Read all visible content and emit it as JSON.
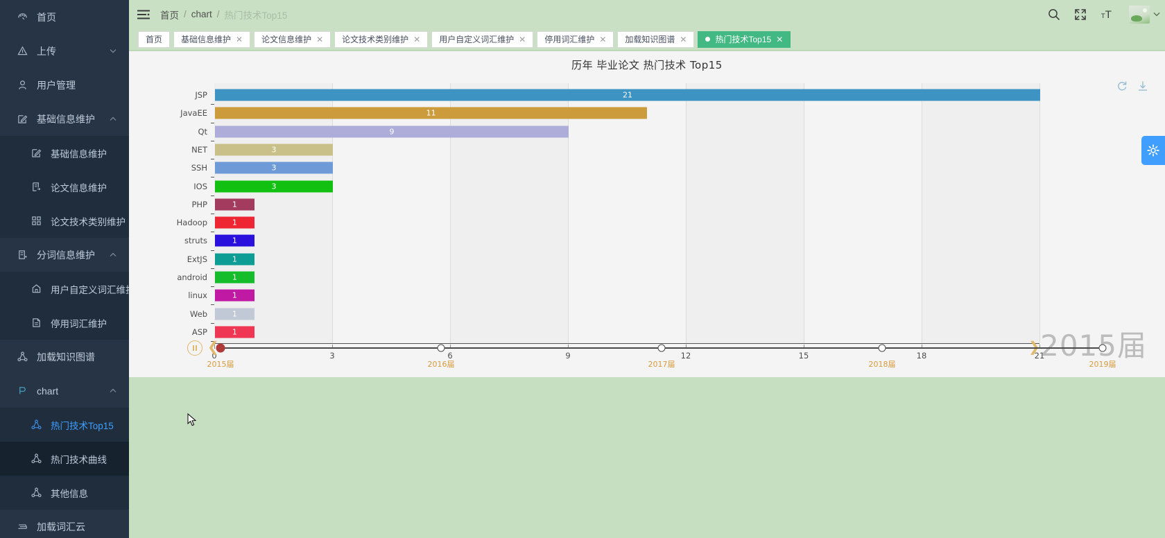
{
  "sidebar": {
    "items": [
      {
        "id": "home",
        "label": "首页",
        "icon": "dashboard-icon",
        "level": 0,
        "arrow": null
      },
      {
        "id": "upload",
        "label": "上传",
        "icon": "upload-icon",
        "level": 0,
        "arrow": "down"
      },
      {
        "id": "user-manage",
        "label": "用户管理",
        "icon": "user-icon",
        "level": 0,
        "arrow": null
      },
      {
        "id": "base-info",
        "label": "基础信息维护",
        "icon": "edit-icon",
        "level": 0,
        "arrow": "up"
      },
      {
        "id": "base-info-child",
        "label": "基础信息维护",
        "icon": "edit-icon",
        "level": 1,
        "arrow": null
      },
      {
        "id": "paper-info",
        "label": "论文信息维护",
        "icon": "doc-icon",
        "level": 1,
        "arrow": null
      },
      {
        "id": "paper-tech-cat",
        "label": "论文技术类别维护",
        "icon": "grid-icon",
        "level": 1,
        "arrow": null
      },
      {
        "id": "seg-info",
        "label": "分词信息维护",
        "icon": "book-icon",
        "level": 0,
        "arrow": "up"
      },
      {
        "id": "user-dict",
        "label": "用户自定义词汇维护",
        "icon": "tag-icon",
        "level": 1,
        "arrow": null
      },
      {
        "id": "stop-words",
        "label": "停用词汇维护",
        "icon": "file-icon",
        "level": 1,
        "arrow": null
      },
      {
        "id": "load-kg",
        "label": "加载知识图谱",
        "icon": "share-icon",
        "level": 0,
        "arrow": null
      },
      {
        "id": "chart",
        "label": "chart",
        "icon": "chart-icon",
        "level": 0,
        "arrow": "up"
      },
      {
        "id": "hot-tech-top15",
        "label": "热门技术Top15",
        "icon": "share-icon",
        "level": 1,
        "arrow": null
      },
      {
        "id": "hot-tech-curve",
        "label": "热门技术曲线",
        "icon": "share-icon",
        "level": 1,
        "arrow": null
      },
      {
        "id": "other-info",
        "label": "其他信息",
        "icon": "share-icon",
        "level": 1,
        "arrow": null
      },
      {
        "id": "load-wordcloud",
        "label": "加载词汇云",
        "icon": "cloud-icon",
        "level": 0,
        "arrow": null
      }
    ]
  },
  "header": {
    "hamburger_icon": "hamburger-icon",
    "breadcrumb": [
      "首页",
      "chart",
      "热门技术Top15"
    ],
    "separator": "/",
    "icons": [
      "search-icon",
      "fullscreen-icon",
      "text-size-icon"
    ],
    "avatar_caret": "▾"
  },
  "tabs": [
    {
      "label": "首页",
      "closable": false,
      "active": false
    },
    {
      "label": "基础信息维护",
      "closable": true,
      "active": false
    },
    {
      "label": "论文信息维护",
      "closable": true,
      "active": false
    },
    {
      "label": "论文技术类别维护",
      "closable": true,
      "active": false
    },
    {
      "label": "用户自定义词汇维护",
      "closable": true,
      "active": false
    },
    {
      "label": "停用词汇维护",
      "closable": true,
      "active": false
    },
    {
      "label": "加载知识图谱",
      "closable": true,
      "active": false
    },
    {
      "label": "热门技术Top15",
      "closable": true,
      "active": true
    }
  ],
  "chart_tools": [
    {
      "name": "refresh-icon"
    },
    {
      "name": "download-icon"
    }
  ],
  "chart_data": {
    "type": "bar",
    "orientation": "horizontal",
    "title": "历年 毕业论文 热门技术 Top15",
    "xlabel": "",
    "ylabel": "",
    "xlim": [
      0,
      21
    ],
    "xticks": [
      0,
      3,
      6,
      9,
      12,
      15,
      18,
      21
    ],
    "grid": true,
    "watermark": "2015届",
    "categories": [
      "JSP",
      "JavaEE",
      "Qt",
      "NET",
      "SSH",
      "IOS",
      "PHP",
      "Hadoop",
      "struts",
      "ExtJS",
      "android",
      "linux",
      "Web",
      "ASP"
    ],
    "values": [
      21,
      11,
      9,
      3,
      3,
      3,
      1,
      1,
      1,
      1,
      1,
      1,
      1,
      1
    ],
    "colors": [
      "#3d93c1",
      "#cb9b3c",
      "#aeadd9",
      "#c9c089",
      "#6e9bd8",
      "#12c012",
      "#a33b5e",
      "#ee2634",
      "#2a10dd",
      "#0e9d94",
      "#16bd2b",
      "#c01aa5",
      "#c1c8d6",
      "#ef3652"
    ],
    "labels": [
      "21",
      "11",
      "9",
      "3",
      "3",
      "3",
      "1",
      "1",
      "1",
      "1",
      "1",
      "1",
      "1",
      "1"
    ]
  },
  "timeline": {
    "play_icon": "pause-icon",
    "prev_icon": "chevron-left-icon",
    "next_icon": "chevron-right-icon",
    "current_index": 0,
    "nodes": [
      {
        "label": "2015届"
      },
      {
        "label": "2016届"
      },
      {
        "label": "2017届"
      },
      {
        "label": "2018届"
      },
      {
        "label": "2019届"
      }
    ]
  },
  "float_settings": {
    "icon": "gear-icon"
  },
  "colors": {
    "sidebar_bg": "#263445",
    "sidebar_sub_bg": "#1f2d3d",
    "header_bg": "#c9e0c4",
    "accent_green": "#42b983",
    "accent_blue": "#409eff",
    "timeline_label": "#d79a3c"
  }
}
